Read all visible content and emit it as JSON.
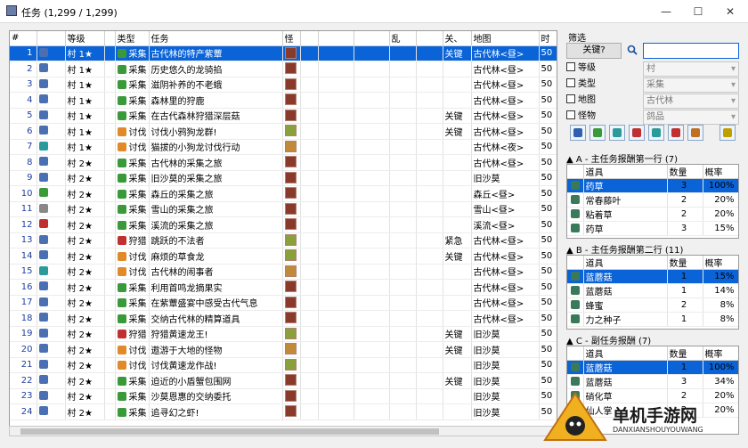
{
  "window": {
    "title": "任务 (1,299 / 1,299)",
    "controls": [
      "—",
      "☐",
      "✕"
    ]
  },
  "columns": [
    "#",
    "",
    "等级",
    "",
    "类型",
    "任务",
    "怪",
    "",
    "",
    "",
    "乱",
    "",
    "关、",
    "地图",
    "时",
    "影"
  ],
  "rows": [
    {
      "id": "1",
      "level": "村 1★",
      "type": "采集",
      "name": "古代林的特产紫蕈",
      "key": "关键",
      "map": "古代林<昼>",
      "t": "50",
      "ic": "#4a6fb3",
      "tc": "#3a9a3a",
      "m": 1
    },
    {
      "id": "2",
      "level": "村 1★",
      "type": "采集",
      "name": "历史悠久的龙骑掐",
      "key": "",
      "map": "古代林<昼>",
      "t": "50",
      "ic": "#4a6fb3",
      "tc": "#3a9a3a",
      "m": 1
    },
    {
      "id": "3",
      "level": "村 1★",
      "type": "采集",
      "name": "滋阴补养的不老蛾",
      "key": "",
      "map": "古代林<昼>",
      "t": "50",
      "ic": "#4a6fb3",
      "tc": "#3a9a3a",
      "m": 1
    },
    {
      "id": "4",
      "level": "村 1★",
      "type": "采集",
      "name": "森林里的狩鹿",
      "key": "",
      "map": "古代林<昼>",
      "t": "50",
      "ic": "#4a6fb3",
      "tc": "#3a9a3a",
      "m": 1
    },
    {
      "id": "5",
      "level": "村 1★",
      "type": "采集",
      "name": "在古代森林狩猎深层菇",
      "key": "关键",
      "map": "古代林<昼>",
      "t": "50",
      "ic": "#4a6fb3",
      "tc": "#3a9a3a",
      "m": 1
    },
    {
      "id": "6",
      "level": "村 1★",
      "type": "讨伐",
      "name": "讨伐小鸦狗龙群!",
      "key": "关键",
      "map": "古代林<昼>",
      "t": "50",
      "ic": "#4a6fb3",
      "tc": "#e08a2a",
      "m": 2
    },
    {
      "id": "7",
      "level": "村 1★",
      "type": "讨伐",
      "name": "猫拔的小狗龙讨伐行动",
      "key": "",
      "map": "古代林<夜>",
      "t": "50",
      "ic": "#2a9a9a",
      "tc": "#e08a2a",
      "m": 3
    },
    {
      "id": "8",
      "level": "村 2★",
      "type": "采集",
      "name": "古代林的采集之旅",
      "key": "",
      "map": "古代林<昼>",
      "t": "50",
      "ic": "#4a6fb3",
      "tc": "#3a9a3a",
      "m": 1
    },
    {
      "id": "9",
      "level": "村 2★",
      "type": "采集",
      "name": "旧沙莫的采集之旅",
      "key": "",
      "map": "旧沙莫",
      "t": "50",
      "ic": "#4a6fb3",
      "tc": "#3a9a3a",
      "m": 1
    },
    {
      "id": "10",
      "level": "村 2★",
      "type": "采集",
      "name": "森丘的采集之旅",
      "key": "",
      "map": "森丘<昼>",
      "t": "50",
      "ic": "#3a9a3a",
      "tc": "#3a9a3a",
      "m": 1
    },
    {
      "id": "11",
      "level": "村 2★",
      "type": "采集",
      "name": "雪山的采集之旅",
      "key": "",
      "map": "雪山<昼>",
      "t": "50",
      "ic": "#888",
      "tc": "#3a9a3a",
      "m": 1
    },
    {
      "id": "12",
      "level": "村 2★",
      "type": "采集",
      "name": "溪流的采集之旅",
      "key": "",
      "map": "溪流<昼>",
      "t": "50",
      "ic": "#c03030",
      "tc": "#3a9a3a",
      "m": 1
    },
    {
      "id": "13",
      "level": "村 2★",
      "type": "狩猎",
      "name": "跳跃的不法者",
      "key": "紧急",
      "map": "古代林<昼>",
      "t": "50",
      "ic": "#4a6fb3",
      "tc": "#c03030",
      "m": 2
    },
    {
      "id": "14",
      "level": "村 2★",
      "type": "讨伐",
      "name": "麻烦的草食龙",
      "key": "关键",
      "map": "古代林<昼>",
      "t": "50",
      "ic": "#4a6fb3",
      "tc": "#e08a2a",
      "m": 2
    },
    {
      "id": "15",
      "level": "村 2★",
      "type": "讨伐",
      "name": "古代林的闹事者",
      "key": "",
      "map": "古代林<昼>",
      "t": "50",
      "ic": "#2a9a9a",
      "tc": "#e08a2a",
      "m": 3
    },
    {
      "id": "16",
      "level": "村 2★",
      "type": "采集",
      "name": "利用首鸣龙摘果实",
      "key": "",
      "map": "古代林<昼>",
      "t": "50",
      "ic": "#4a6fb3",
      "tc": "#3a9a3a",
      "m": 1
    },
    {
      "id": "17",
      "level": "村 2★",
      "type": "采集",
      "name": "在紫蕈盛宴中感受古代气息",
      "key": "",
      "map": "古代林<昼>",
      "t": "50",
      "ic": "#4a6fb3",
      "tc": "#3a9a3a",
      "m": 1
    },
    {
      "id": "18",
      "level": "村 2★",
      "type": "采集",
      "name": "交纳古代林的精算道具",
      "key": "",
      "map": "古代林<昼>",
      "t": "50",
      "ic": "#4a6fb3",
      "tc": "#3a9a3a",
      "m": 1
    },
    {
      "id": "19",
      "level": "村 2★",
      "type": "狩猎",
      "name": "狩猎黄速龙王!",
      "key": "关键",
      "map": "旧沙莫",
      "t": "50",
      "ic": "#4a6fb3",
      "tc": "#c03030",
      "m": 2
    },
    {
      "id": "20",
      "level": "村 2★",
      "type": "讨伐",
      "name": "遨游于大地的怪物",
      "key": "关键",
      "map": "旧沙莫",
      "t": "50",
      "ic": "#4a6fb3",
      "tc": "#e08a2a",
      "m": 3
    },
    {
      "id": "21",
      "level": "村 2★",
      "type": "讨伐",
      "name": "讨伐黄速龙作战!",
      "key": "",
      "map": "旧沙莫",
      "t": "50",
      "ic": "#4a6fb3",
      "tc": "#e08a2a",
      "m": 2
    },
    {
      "id": "22",
      "level": "村 2★",
      "type": "采集",
      "name": "迫近的小盾蟹包围网",
      "key": "关键",
      "map": "旧沙莫",
      "t": "50",
      "ic": "#4a6fb3",
      "tc": "#3a9a3a",
      "m": 1
    },
    {
      "id": "23",
      "level": "村 2★",
      "type": "采集",
      "name": "沙莫恩惠的交纳委托",
      "key": "",
      "map": "旧沙莫",
      "t": "50",
      "ic": "#4a6fb3",
      "tc": "#3a9a3a",
      "m": 1
    },
    {
      "id": "24",
      "level": "村 2★",
      "type": "采集",
      "name": "追寻幻之虾!",
      "key": "",
      "map": "旧沙莫",
      "t": "50",
      "ic": "#4a6fb3",
      "tc": "#3a9a3a",
      "m": 1
    }
  ],
  "filter": {
    "title": "筛选",
    "keyword_button": "关键?",
    "search_value": "",
    "checks": [
      {
        "label": "等级",
        "value": "村"
      },
      {
        "label": "类型",
        "value": "采集"
      },
      {
        "label": "地图",
        "value": "古代林"
      },
      {
        "label": "怪物",
        "value": "鸽品"
      }
    ],
    "icon_colors": [
      "#3060b0",
      "#3a9a3a",
      "#2a9a9a",
      "#c03030",
      "#2a9a9a",
      "#c03030",
      "#c07020",
      "#c0a000"
    ]
  },
  "reward_a": {
    "title": "▲ A - 主任务报酬第一行 (7)",
    "headers": [
      "道具",
      "数量",
      "概率"
    ],
    "rows": [
      [
        "药草",
        "3",
        "100%"
      ],
      [
        "常春藤叶",
        "2",
        "20%"
      ],
      [
        "粘着草",
        "2",
        "20%"
      ],
      [
        "药草",
        "3",
        "15%"
      ]
    ]
  },
  "reward_b": {
    "title": "▲ B - 主任务报酬第二行 (11)",
    "headers": [
      "道具",
      "数量",
      "概率"
    ],
    "rows": [
      [
        "蓝蘑菇",
        "1",
        "15%"
      ],
      [
        "蓝蘑菇",
        "1",
        "14%"
      ],
      [
        "蜂蜜",
        "2",
        "8%"
      ],
      [
        "力之种子",
        "1",
        "8%"
      ]
    ]
  },
  "reward_c": {
    "title": "▲ C - 副任务报酬 (7)",
    "headers": [
      "道具",
      "数量",
      "概率"
    ],
    "rows": [
      [
        "蓝蘑菇",
        "1",
        "100%"
      ],
      [
        "蓝蘑菇",
        "3",
        "34%"
      ],
      [
        "硝化草",
        "2",
        "20%"
      ],
      [
        "仙人掌",
        "2",
        "20%"
      ]
    ]
  },
  "watermark": {
    "brand": "单机手游网",
    "site": "DANXIANSHOUYOUWANG"
  }
}
